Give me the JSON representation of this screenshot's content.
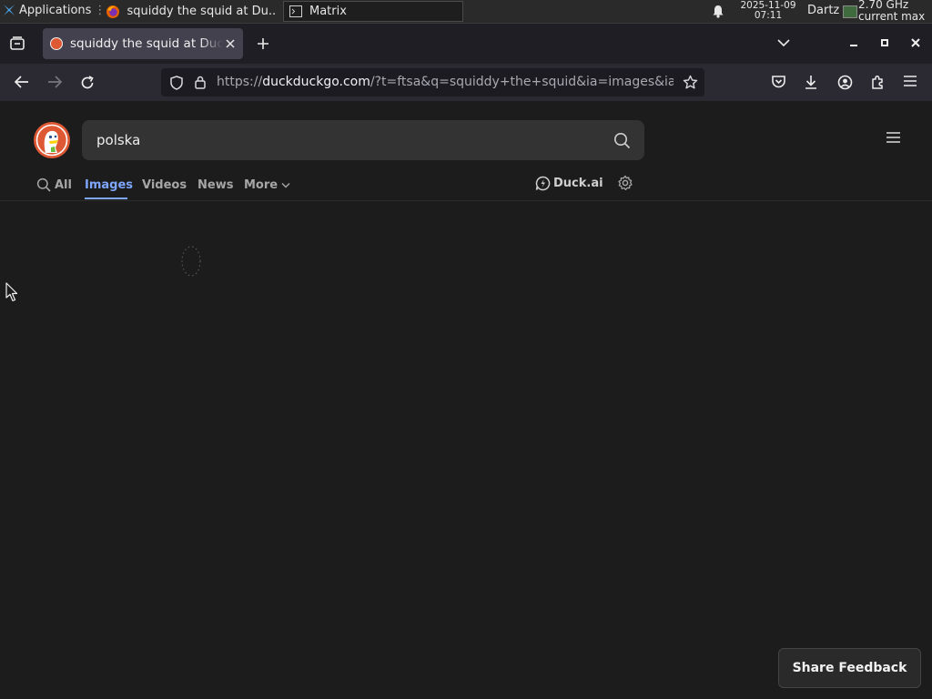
{
  "taskbar": {
    "apps_label": "Applications",
    "tasks": [
      {
        "label": "squiddy the squid at Du..."
      },
      {
        "label": "Matrix"
      }
    ],
    "clock": {
      "date": "2025-11-09",
      "time": "07:11"
    },
    "user": "Dartz",
    "cpu": {
      "freq": "2.70 GHz",
      "mode": "current max"
    }
  },
  "browser": {
    "tab": {
      "title": "squiddy the squid at DuckDuckGo"
    },
    "url": {
      "scheme": "https://",
      "host": "duckduckgo.com",
      "rest": "/?t=ftsa&q=squiddy+the+squid&ia=images&iax=images"
    }
  },
  "search": {
    "query": "polska",
    "tabs": [
      {
        "label": "All"
      },
      {
        "label": "Images"
      },
      {
        "label": "Videos"
      },
      {
        "label": "News"
      },
      {
        "label": "More"
      }
    ],
    "active_tab": "Images",
    "duckai_label": "Duck.ai"
  },
  "feedback_label": "Share Feedback",
  "colors": {
    "accent": "#7fa6ff",
    "ddg_brand": "#de5833",
    "page_bg": "#1c1c1c"
  },
  "icons": {
    "taskbar": [
      "xfce-apps-icon",
      "firefox-icon",
      "terminal-icon",
      "bell-icon",
      "cpu-graph-icon"
    ],
    "tabstrip": [
      "tab-list-icon",
      "close-icon",
      "plus-icon",
      "chevron-down-icon",
      "minimize-icon",
      "maximize-icon",
      "close-icon"
    ],
    "navbar": [
      "back-arrow-icon",
      "forward-arrow-icon",
      "reload-icon",
      "shield-icon",
      "lock-icon",
      "star-icon",
      "pocket-icon",
      "download-icon",
      "account-icon",
      "extensions-icon",
      "hamburger-menu-icon"
    ],
    "page": [
      "duckduckgo-logo",
      "search-icon",
      "hamburger-menu-icon",
      "chevron-down-icon",
      "duck-ai-icon",
      "gear-icon",
      "loading-spinner-icon"
    ]
  }
}
